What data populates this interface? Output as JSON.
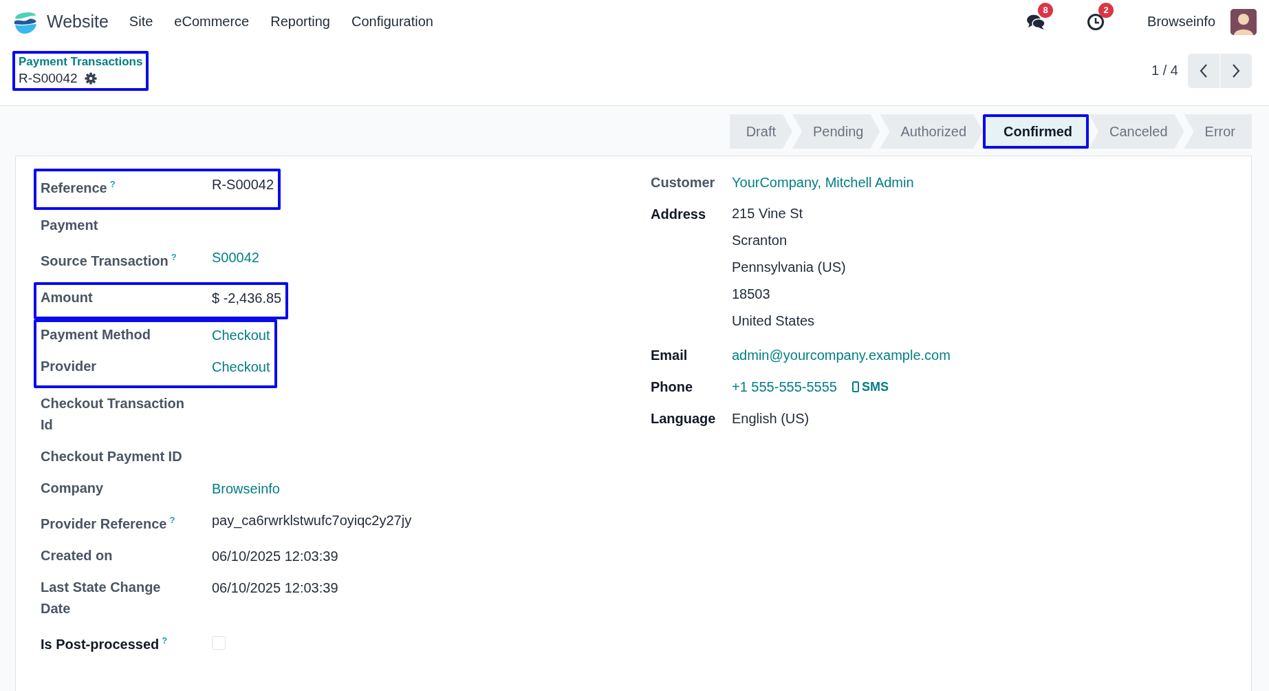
{
  "navbar": {
    "app_name": "Website",
    "menu": [
      "Site",
      "eCommerce",
      "Reporting",
      "Configuration"
    ],
    "messages_badge": "8",
    "activities_badge": "2",
    "user": "Browseinfo"
  },
  "breadcrumb": {
    "parent": "Payment Transactions",
    "current": "R-S00042",
    "highlighted": true
  },
  "pager": {
    "text": "1 / 4"
  },
  "statusbar": [
    {
      "label": "Draft",
      "selected": false,
      "highlighted": false
    },
    {
      "label": "Pending",
      "selected": false,
      "highlighted": false
    },
    {
      "label": "Authorized",
      "selected": false,
      "highlighted": false
    },
    {
      "label": "Confirmed",
      "selected": true,
      "highlighted": true
    },
    {
      "label": "Canceled",
      "selected": false,
      "highlighted": false
    },
    {
      "label": "Error",
      "selected": false,
      "highlighted": false
    }
  ],
  "left_groups": [
    {
      "highlighted": true,
      "fields": [
        {
          "label": "Reference",
          "strong": false,
          "help": "?",
          "kind": "text",
          "value": "R-S00042"
        }
      ]
    },
    {
      "highlighted": false,
      "fields": [
        {
          "label": "Payment",
          "strong": false,
          "kind": "empty"
        },
        {
          "label": "Source Transaction",
          "strong": false,
          "help": "?",
          "kind": "link",
          "value": "S00042"
        }
      ]
    },
    {
      "highlighted": true,
      "fields": [
        {
          "label": "Amount",
          "strong": false,
          "kind": "text",
          "value": "$ -2,436.85"
        }
      ]
    },
    {
      "highlighted": true,
      "fields": [
        {
          "label": "Payment Method",
          "strong": false,
          "kind": "link",
          "value": "Checkout"
        },
        {
          "label": "Provider",
          "strong": false,
          "kind": "link",
          "value": "Checkout"
        }
      ]
    },
    {
      "highlighted": false,
      "fields": [
        {
          "label": "Checkout Transaction Id",
          "strong": false,
          "kind": "empty"
        },
        {
          "label": "Checkout Payment ID",
          "strong": false,
          "kind": "empty"
        },
        {
          "label": "Company",
          "strong": false,
          "kind": "link",
          "value": "Browseinfo"
        },
        {
          "label": "Provider Reference",
          "strong": false,
          "help": "?",
          "kind": "text",
          "value": "pay_ca6rwrklstwufc7oyiqc2y27jy"
        },
        {
          "label": "Created on",
          "strong": false,
          "kind": "text",
          "value": "06/10/2025 12:03:39"
        },
        {
          "label": "Last State Change Date",
          "strong": false,
          "kind": "text",
          "value": "06/10/2025 12:03:39"
        },
        {
          "label": "Is Post-processed",
          "strong": true,
          "help": "?",
          "kind": "checkbox",
          "checked": false
        }
      ]
    }
  ],
  "right_fields": [
    {
      "label": "Customer",
      "strong": false,
      "kind": "link",
      "value": "YourCompany, Mitchell Admin"
    },
    {
      "label": "Address",
      "strong": true,
      "kind": "lines",
      "lines": [
        "215 Vine St",
        "Scranton",
        "Pennsylvania (US)",
        "18503",
        "United States"
      ]
    },
    {
      "label": "Email",
      "strong": true,
      "kind": "link",
      "value": "admin@yourcompany.example.com"
    },
    {
      "label": "Phone",
      "strong": true,
      "kind": "phone",
      "value": "+1 555-555-5555",
      "action": "SMS"
    },
    {
      "label": "Language",
      "strong": true,
      "kind": "text",
      "value": "English (US)"
    }
  ]
}
